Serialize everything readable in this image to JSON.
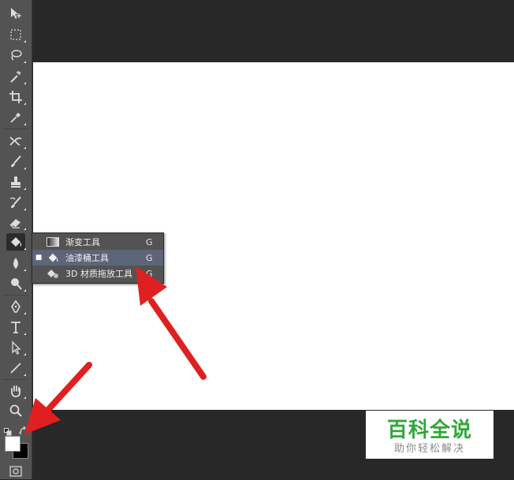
{
  "flyout_menu": {
    "items": [
      {
        "label": "渐变工具",
        "shortcut": "G",
        "selected": false
      },
      {
        "label": "油漆桶工具",
        "shortcut": "G",
        "selected": true
      },
      {
        "label": "3D 材质拖放工具",
        "shortcut": "G",
        "selected": false
      }
    ],
    "selected_marker": "■"
  },
  "toolbar": {
    "tools": [
      "move-icon",
      "marquee-icon",
      "lasso-icon",
      "magic-wand-icon",
      "crop-icon",
      "eyedropper-icon",
      "healing-brush-icon",
      "brush-icon",
      "clone-stamp-icon",
      "history-brush-icon",
      "eraser-icon",
      "paint-bucket-icon",
      "blur-icon",
      "dodge-icon",
      "pen-icon",
      "type-icon",
      "path-selection-icon",
      "line-icon",
      "hand-icon",
      "zoom-icon"
    ],
    "foreground_color": "#ffffff",
    "background_color": "#000000"
  },
  "watermark": {
    "title": "百科全说",
    "subtitle": "助你轻松解决",
    "title_color": "#2ea836"
  },
  "annotation_color": "#e02020"
}
